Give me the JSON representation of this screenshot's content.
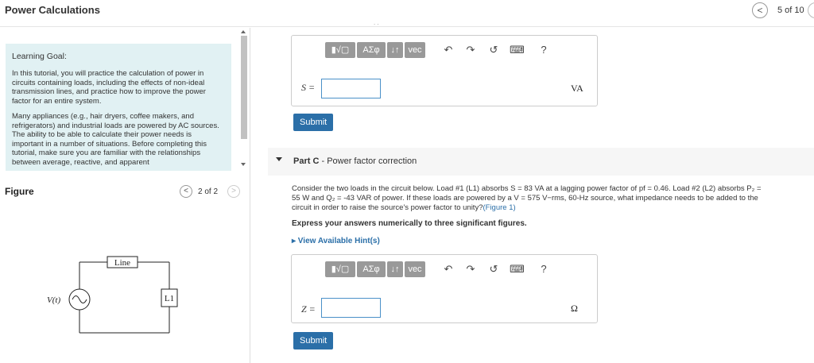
{
  "header": {
    "title": "Power Calculations",
    "page_prev_glyph": "<",
    "page_count": "5 of 10"
  },
  "learning_goal": {
    "title": "Learning Goal:",
    "paragraph1": "In this tutorial, you will practice the calculation of power in circuits containing loads, including the effects of non-ideal transmission lines, and practice how to improve the power factor for an entire system.",
    "paragraph2": "Many appliances (e.g., hair dryers, coffee makers, and refrigerators) and industrial loads are powered by AC sources. The ability to be able to calculate their power needs is important in a number of situations. Before completing this tutorial, make sure you are familiar with the relationships between average, reactive, and apparent"
  },
  "figure": {
    "label": "Figure",
    "prev_glyph": "<",
    "next_glyph": ">",
    "count": "2 of 2",
    "source_label": "V(t)",
    "line_label": "Line",
    "load_label": "L1"
  },
  "toolbar": {
    "templates_label": "▮√▢",
    "greek_label": "ΑΣφ",
    "arrows_label": "↓↑",
    "vec_label": "vec",
    "undo_icon": "↶",
    "redo_icon": "↷",
    "reset_icon": "↺",
    "keyboard_icon": "⌨",
    "help_icon": "?"
  },
  "part_b": {
    "var_label": "S =",
    "input_value": "",
    "unit": "VA",
    "submit_label": "Submit"
  },
  "part_c": {
    "part_name": "Part C",
    "title": "Power factor correction",
    "problem_line1": "Consider the two loads in the circuit below. Load #1 (L1) absorbs S = 83 VA at a lagging power factor of pf = 0.46. Load #2 (L2) absorbs P₂ =",
    "problem_line2": "55 W and Q₂ = -43 VAR of power. If these loads are powered by a V = 575 V−rms, 60-Hz source, what impedance needs to be added to the",
    "problem_line3": "circuit in order to raise the source's power factor to unity?",
    "figure_link": "(Figure 1)",
    "instruction": "Express your answers numerically to three significant figures.",
    "hints_link": "▸ View Available Hint(s)",
    "var_label": "Z =",
    "input_value": "",
    "unit": "Ω",
    "submit_label": "Submit"
  }
}
